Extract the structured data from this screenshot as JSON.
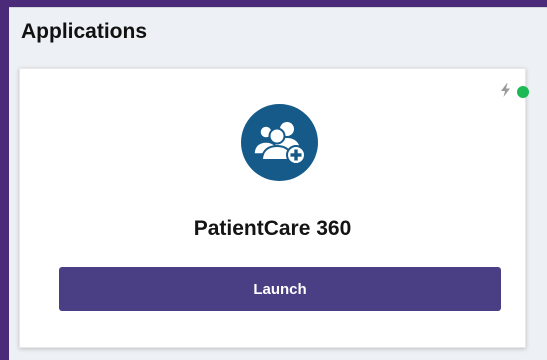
{
  "section": {
    "title": "Applications"
  },
  "app_card": {
    "name": "PatientCare 360",
    "icon": "add-patients-icon",
    "status_icon": "lightning-bolt-icon",
    "status": "online",
    "launch_label": "Launch"
  },
  "colors": {
    "frame_accent": "#4b2a7a",
    "page_background": "#edf0f4",
    "icon_background": "#165a8a",
    "button_background": "#4a3e84",
    "status_online": "#1db954"
  }
}
